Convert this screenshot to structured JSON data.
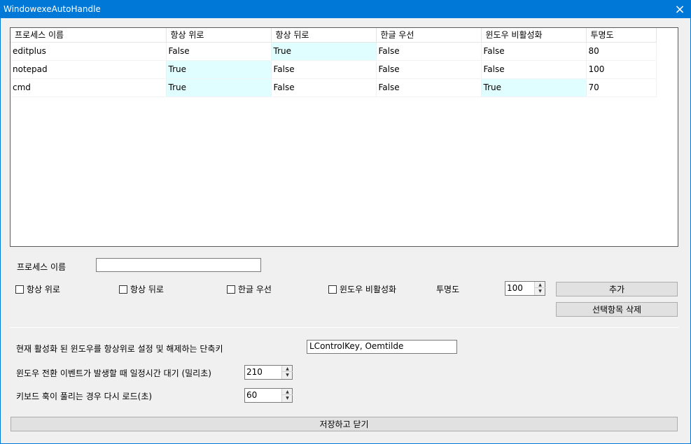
{
  "window": {
    "title": "WindowexeAutoHandle",
    "close_icon": "×"
  },
  "grid": {
    "columns": [
      "프로세스 이름",
      "항상 위로",
      "항상 뒤로",
      "한글 우선",
      "윈도우 비활성화",
      "투명도"
    ],
    "rows": [
      [
        "editplus",
        "False",
        "True",
        "False",
        "False",
        "80"
      ],
      [
        "notepad",
        "True",
        "False",
        "False",
        "False",
        "100"
      ],
      [
        "cmd",
        "True",
        "False",
        "False",
        "True",
        "70"
      ]
    ],
    "highlight_color": "#e0feff"
  },
  "form": {
    "process_name_label": "프로세스 이름",
    "process_name_value": "",
    "always_top_label": "항상 위로",
    "always_bottom_label": "항상 뒤로",
    "hangul_first_label": "한글 우선",
    "window_disable_label": "윈도우 비활성화",
    "opacity_label": "투명도",
    "opacity_value": "100",
    "add_button": "추가",
    "delete_button": "선택항목 삭제"
  },
  "settings": {
    "hotkey_label": "현재 활성화 된 윈도우를 항상위로 설정 및 해제하는 단축키",
    "hotkey_value": "LControlKey, Oemtilde",
    "wait_label": "윈도우 전환 이벤트가 발생할 때 일정시간 대기 (밀리초)",
    "wait_value": "210",
    "reload_label": "키보드 훅이 풀리는 경우 다시 로드(초)",
    "reload_value": "60"
  },
  "save_button": "저장하고 닫기"
}
